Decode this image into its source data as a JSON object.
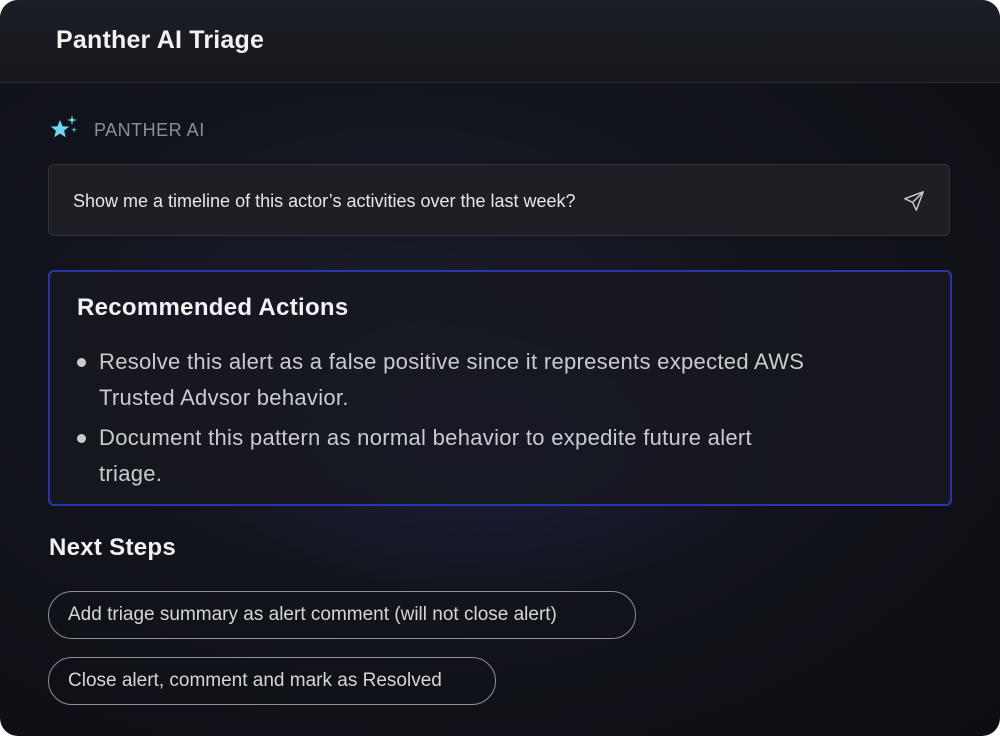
{
  "header": {
    "title": "Panther AI Triage"
  },
  "assistant": {
    "label": "PANTHER AI",
    "icon": "sparkle-icon",
    "accent": "#6fd6ee"
  },
  "prompt": {
    "text": "Show me a timeline of this actor’s activities over the last week?",
    "send_icon": "send-icon"
  },
  "recommended": {
    "title": "Recommended Actions",
    "items": [
      {
        "line1": "Resolve this alert as a false positive since it represents expected AWS",
        "line2": "Trusted Advsor behavior."
      },
      {
        "line1": "Document this pattern as normal behavior to expedite future alert",
        "line2": "triage."
      }
    ],
    "border_color": "#2b34a8"
  },
  "next_steps": {
    "title": "Next Steps",
    "buttons": [
      "Add triage summary as alert comment (will not close alert)",
      "Close alert, comment and mark as Resolved"
    ]
  }
}
